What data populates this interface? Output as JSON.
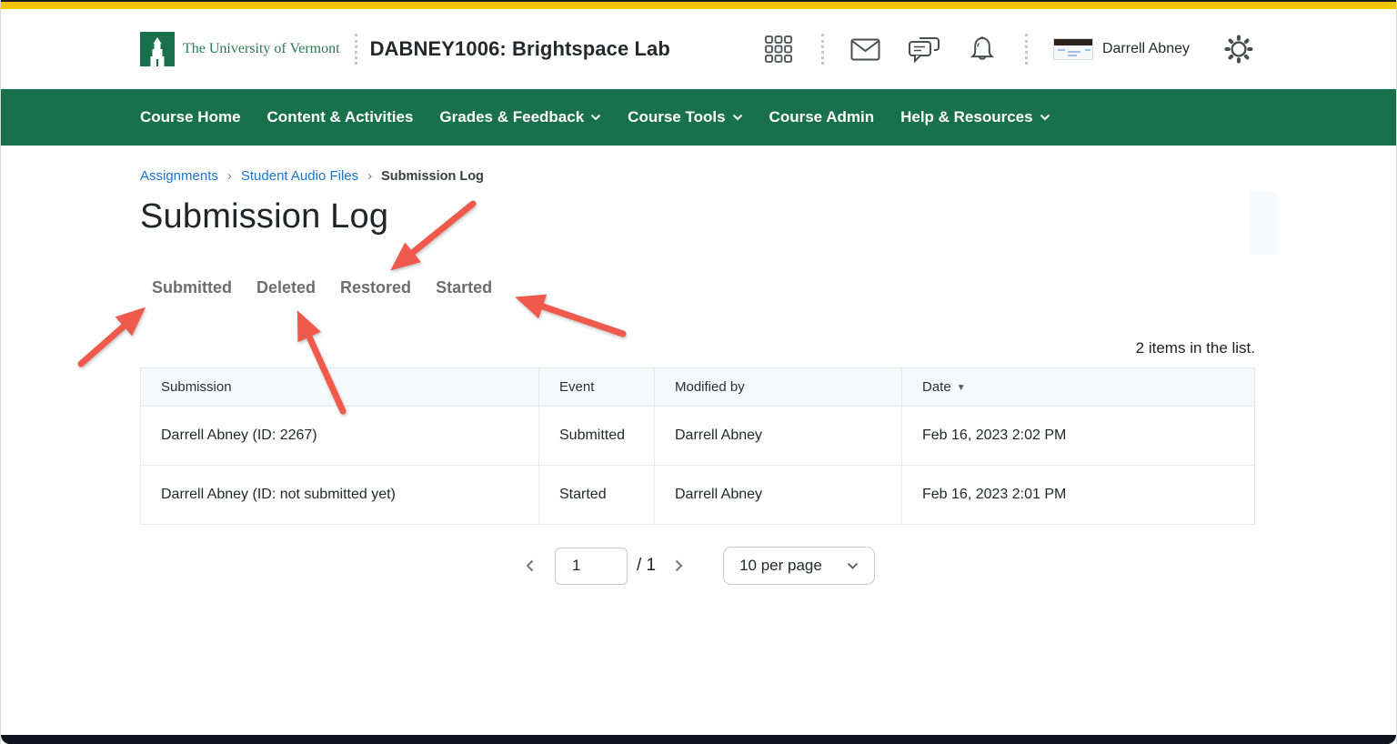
{
  "window": {
    "top_accent_color": "#F2C301",
    "bottom_bar_color": "#0E1420"
  },
  "header": {
    "institution_name": "The University of Vermont",
    "course_title": "DABNEY1006: Brightspace Lab",
    "user_name": "Darrell Abney",
    "icons": [
      "app-grid-icon",
      "email-icon",
      "chat-icon",
      "bell-icon",
      "gear-icon"
    ]
  },
  "nav": {
    "background_color": "#19704C",
    "items": [
      {
        "label": "Course Home",
        "has_dropdown": false
      },
      {
        "label": "Content & Activities",
        "has_dropdown": false
      },
      {
        "label": "Grades & Feedback",
        "has_dropdown": true
      },
      {
        "label": "Course Tools",
        "has_dropdown": true
      },
      {
        "label": "Course Admin",
        "has_dropdown": false
      },
      {
        "label": "Help & Resources",
        "has_dropdown": true
      }
    ]
  },
  "breadcrumb": {
    "items": [
      "Assignments",
      "Student Audio Files",
      "Submission Log"
    ]
  },
  "page": {
    "title": "Submission Log"
  },
  "filter_tabs": [
    "Submitted",
    "Deleted",
    "Restored",
    "Started"
  ],
  "list_summary": "2 items in the list.",
  "table": {
    "columns": [
      "Submission",
      "Event",
      "Modified by",
      "Date"
    ],
    "sorted_by": "Date",
    "sort_direction": "descending",
    "sort_indicator": "▼",
    "rows": [
      {
        "submission": "Darrell Abney (ID: 2267)",
        "event": "Submitted",
        "modified_by": "Darrell Abney",
        "date": "Feb 16, 2023 2:02 PM"
      },
      {
        "submission": "Darrell Abney (ID: not submitted yet)",
        "event": "Started",
        "modified_by": "Darrell Abney",
        "date": "Feb 16, 2023 2:01 PM"
      }
    ]
  },
  "pagination": {
    "current_page": "1",
    "page_total_label": "/ 1",
    "per_page_selected": "10 per page"
  },
  "annotations": {
    "arrow_color": "#EF5A4C",
    "arrow_targets": [
      "Submitted",
      "Deleted",
      "Restored",
      "Started"
    ]
  }
}
